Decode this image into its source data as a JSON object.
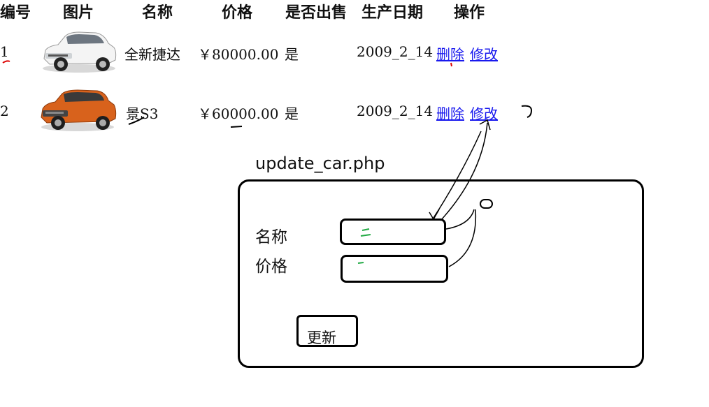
{
  "table": {
    "headers": [
      "编号",
      "图片",
      "名称",
      "价格",
      "是否出售",
      "生产日期",
      "操作"
    ],
    "rows": [
      {
        "id": "1",
        "image": "white-sedan-car-photo",
        "name": "全新捷达",
        "price": "￥80000.00",
        "on_sale": "是",
        "date": "2009_2_14",
        "delete_label": "删除",
        "edit_label": "修改"
      },
      {
        "id": "2",
        "image": "orange-suv-car-photo",
        "name": "景S3",
        "price": "￥60000.00",
        "on_sale": "是",
        "date": "2009_2_14",
        "delete_label": "删除",
        "edit_label": "修改"
      }
    ]
  },
  "sketch": {
    "page_label": "update_car.php",
    "name_label": "名称",
    "price_label": "价格",
    "update_button": "更新"
  },
  "colors": {
    "link": "#1a1aee",
    "red_mark": "#dd0000",
    "green_mark": "#22aa44"
  }
}
